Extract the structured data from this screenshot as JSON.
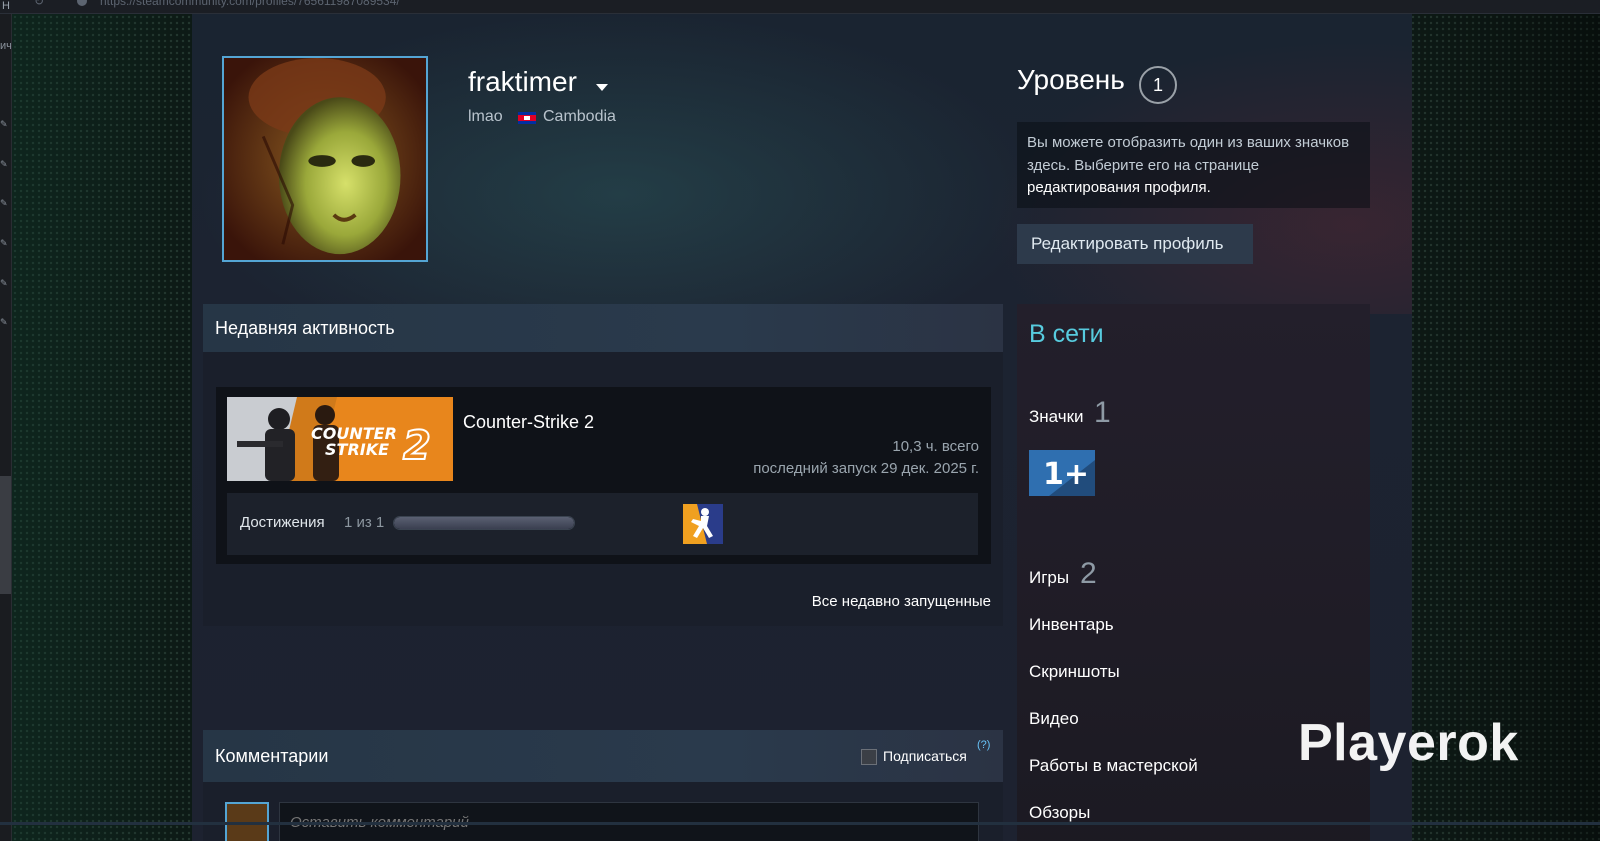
{
  "browser": {
    "url_fragment": "https://steamcommunity.com/profiles/765611987089534/"
  },
  "profile": {
    "username": "fraktimer",
    "realname": "lmao",
    "country": "Cambodia",
    "level_title": "Уровень",
    "level": "1",
    "level_info_text": "Вы можете отобразить один из ваших значков здесь. Выберите его на странице ",
    "level_info_link": "редактирования профиля",
    "level_info_end": ".",
    "edit_button": "Редактировать профиль"
  },
  "activity": {
    "title": "Недавняя активность",
    "game": {
      "name": "Counter-Strike 2",
      "hours": "10,3 ч. всего",
      "last_played": "последний запуск 29 дек. 2025 г.",
      "capsule_text_line1": "COUNTER",
      "capsule_text_line2": "STRIKE",
      "capsule_number": "2",
      "achievements_label": "Достижения",
      "achievements_count": "1 из 1",
      "achievements_fraction": 1.0
    },
    "all_recent_link": "Все недавно запущенные"
  },
  "comments": {
    "title": "Комментарии",
    "subscribe_label": "Подписаться",
    "help": "(?)",
    "input_placeholder": "Оставить комментарий"
  },
  "sidebar": {
    "status": "В сети",
    "badges_label": "Значки",
    "badges_count": "1",
    "badge_text": "1+",
    "games_label": "Игры",
    "games_count": "2",
    "links": [
      "Инвентарь",
      "Скриншоты",
      "Видео",
      "Работы в мастерской",
      "Обзоры"
    ]
  },
  "watermark": "Playerok",
  "colors": {
    "accent_blue": "#54a5d4",
    "online_cyan": "#57cbde",
    "cs2_orange": "#e8861c"
  }
}
